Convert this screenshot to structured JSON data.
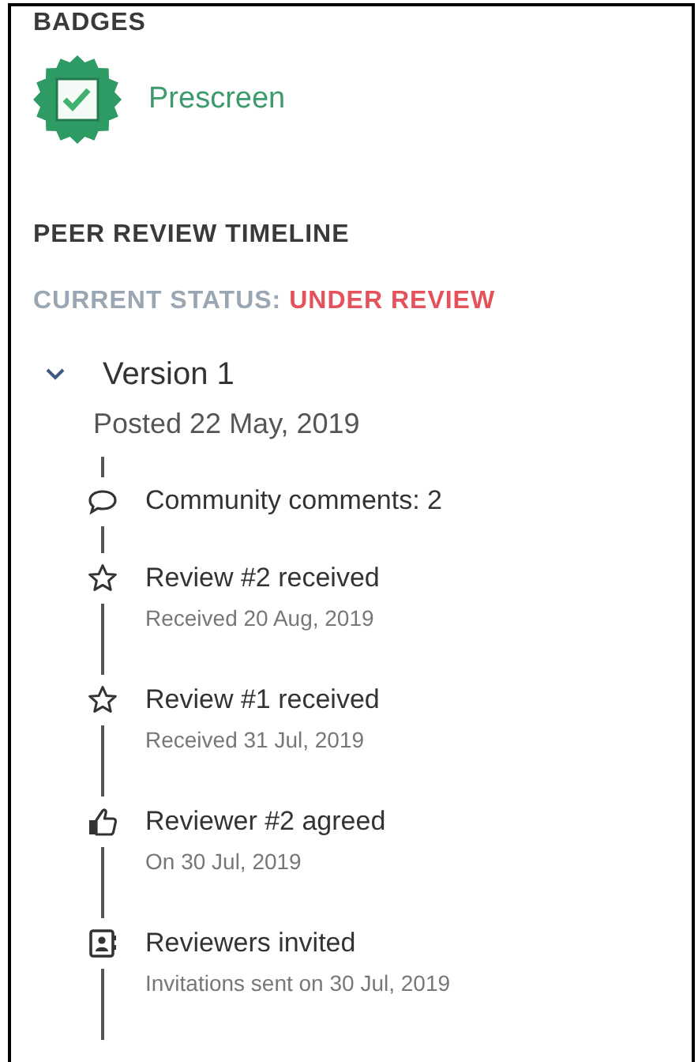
{
  "badges": {
    "heading": "BADGES",
    "items": [
      {
        "label": "Prescreen"
      }
    ]
  },
  "timeline": {
    "heading": "PEER REVIEW TIMELINE",
    "status_label": "CURRENT STATUS:",
    "status_value": "UNDER REVIEW",
    "versions": [
      {
        "title": "Version 1",
        "expanded": true,
        "posted": "Posted 22 May, 2019",
        "events": [
          {
            "kind": "comment",
            "title": "Community comments: 2"
          },
          {
            "kind": "review",
            "title": "Review #2 received",
            "detail": "Received 20 Aug, 2019"
          },
          {
            "kind": "review",
            "title": "Review #1 received",
            "detail": "Received 31 Jul, 2019"
          },
          {
            "kind": "agreed",
            "title": "Reviewer #2 agreed",
            "detail": "On 30 Jul, 2019"
          },
          {
            "kind": "invited",
            "title": "Reviewers invited",
            "detail": "Invitations sent on 30 Jul, 2019"
          }
        ]
      }
    ]
  }
}
